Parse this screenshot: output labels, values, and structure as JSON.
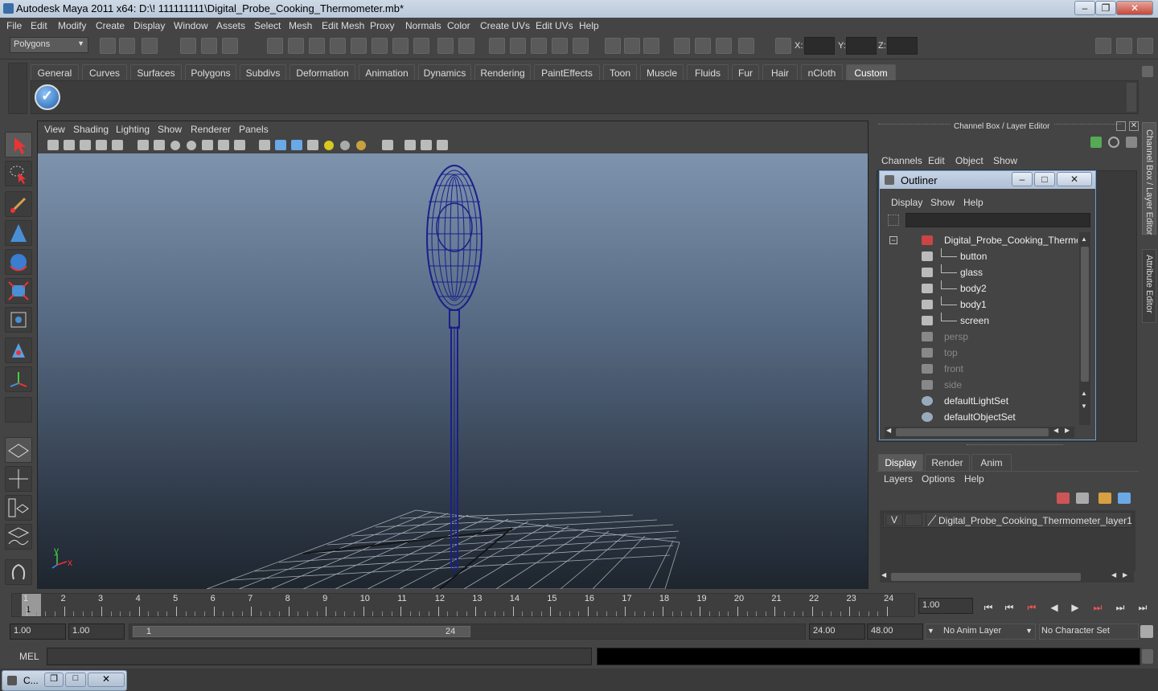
{
  "window": {
    "title": "Autodesk Maya 2011 x64: D:\\! 111111111\\Digital_Probe_Cooking_Thermometer.mb*",
    "minimize": "–",
    "restore": "❐",
    "close": "✕"
  },
  "menus": [
    "File",
    "Edit",
    "Modify",
    "Create",
    "Display",
    "Window",
    "Assets",
    "Select",
    "Mesh",
    "Edit Mesh",
    "Proxy",
    "Normals",
    "Color",
    "Create UVs",
    "Edit UVs",
    "Help"
  ],
  "status_line": {
    "mode": "Polygons",
    "x_label": "X:",
    "y_label": "Y:",
    "z_label": "Z:"
  },
  "shelf_tabs": [
    "General",
    "Curves",
    "Surfaces",
    "Polygons",
    "Subdivs",
    "Deformation",
    "Animation",
    "Dynamics",
    "Rendering",
    "PaintEffects",
    "Toon",
    "Muscle",
    "Fluids",
    "Fur",
    "Hair",
    "nCloth",
    "Custom"
  ],
  "shelf_active": "Custom",
  "viewport": {
    "menus": [
      "View",
      "Shading",
      "Lighting",
      "Show",
      "Renderer",
      "Panels"
    ],
    "axis_y": "y",
    "axis_x": "x"
  },
  "channel_box": {
    "title": "Channel Box / Layer Editor",
    "menus": [
      "Channels",
      "Edit",
      "Object",
      "Show"
    ],
    "side_tab_1": "Channel Box / Layer Editor",
    "side_tab_2": "Attribute Editor"
  },
  "outliner": {
    "title": "Outliner",
    "menus": [
      "Display",
      "Show",
      "Help"
    ],
    "items": [
      {
        "label": "Digital_Probe_Cooking_Thermome",
        "dim": false
      },
      {
        "label": "button",
        "dim": false
      },
      {
        "label": "glass",
        "dim": false
      },
      {
        "label": "body2",
        "dim": false
      },
      {
        "label": "body1",
        "dim": false
      },
      {
        "label": "screen",
        "dim": false
      },
      {
        "label": "persp",
        "dim": true
      },
      {
        "label": "top",
        "dim": true
      },
      {
        "label": "front",
        "dim": true
      },
      {
        "label": "side",
        "dim": true
      },
      {
        "label": "defaultLightSet",
        "dim": false
      },
      {
        "label": "defaultObjectSet",
        "dim": false
      }
    ]
  },
  "layer_editor": {
    "tabs": [
      "Display",
      "Render",
      "Anim"
    ],
    "active_tab": "Display",
    "menus": [
      "Layers",
      "Options",
      "Help"
    ],
    "layer_visible": "V",
    "layer_name": "Digital_Probe_Cooking_Thermometer_layer1"
  },
  "time_slider": {
    "ticks": [
      "1",
      "2",
      "3",
      "4",
      "5",
      "6",
      "7",
      "8",
      "9",
      "10",
      "11",
      "12",
      "13",
      "14",
      "15",
      "16",
      "17",
      "18",
      "19",
      "20",
      "21",
      "22",
      "23",
      "24"
    ],
    "current_frame_marker": "1",
    "current_time": "1.00"
  },
  "range_slider": {
    "start_time": "1.00",
    "playback_start": "1.00",
    "range_start_label": "1",
    "range_end_label": "24",
    "playback_end": "24.00",
    "end_time": "48.00",
    "anim_layer": "No Anim Layer",
    "character_set": "No Character Set"
  },
  "command_line": {
    "label": "MEL"
  },
  "taskbar": {
    "item": "C..."
  },
  "colors": {
    "background": "#444444",
    "wireframe": "#1a1f8c",
    "title_bar": "#c6d4e6"
  }
}
